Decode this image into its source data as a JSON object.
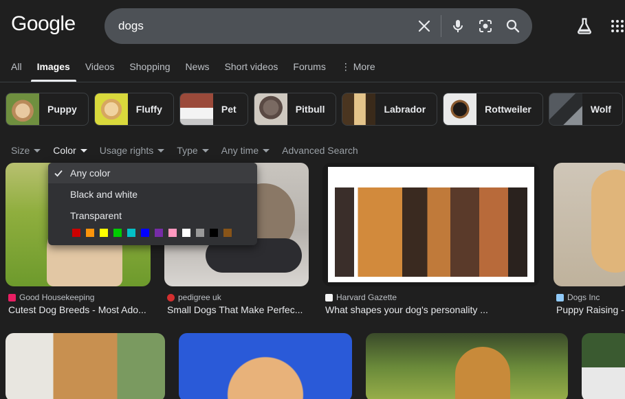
{
  "logo": "Google",
  "search": {
    "query": "dogs",
    "icons": [
      "clear-icon",
      "mic-icon",
      "lens-icon",
      "search-icon"
    ]
  },
  "header_icons": [
    "labs-flask-icon",
    "apps-grid-icon"
  ],
  "tabs": [
    {
      "label": "All"
    },
    {
      "label": "Images",
      "active": true
    },
    {
      "label": "Videos"
    },
    {
      "label": "Shopping"
    },
    {
      "label": "News"
    },
    {
      "label": "Short videos"
    },
    {
      "label": "Forums"
    },
    {
      "label": "More"
    }
  ],
  "chips": [
    {
      "label": "Puppy"
    },
    {
      "label": "Fluffy"
    },
    {
      "label": "Pet"
    },
    {
      "label": "Pitbull"
    },
    {
      "label": "Labrador"
    },
    {
      "label": "Rottweiler"
    },
    {
      "label": "Wolf"
    }
  ],
  "filters": {
    "size": "Size",
    "color": "Color",
    "usage": "Usage rights",
    "type": "Type",
    "time": "Any time",
    "advanced": "Advanced Search"
  },
  "color_menu": {
    "any": "Any color",
    "bw": "Black and white",
    "transparent": "Transparent",
    "swatches": [
      "#cc0000",
      "#fb940b",
      "#ffff00",
      "#00cc00",
      "#03c0c6",
      "#0000ff",
      "#762ca7",
      "#ff98bf",
      "#ffffff",
      "#999999",
      "#000000",
      "#885418"
    ]
  },
  "results": [
    {
      "source": "Good Housekeeping",
      "title": "Cutest Dog Breeds - Most Ado...",
      "fav_color": "#e91e63"
    },
    {
      "source": "pedigree uk",
      "title": "Small Dogs That Make Perfec...",
      "fav_color": "#d32f2f"
    },
    {
      "source": "Harvard Gazette",
      "title": "What shapes your dog's personality ...",
      "fav_color": "#f5f5f5"
    },
    {
      "source": "Dogs Inc",
      "title": "Puppy Raising -",
      "fav_color": "#90caf9"
    }
  ]
}
